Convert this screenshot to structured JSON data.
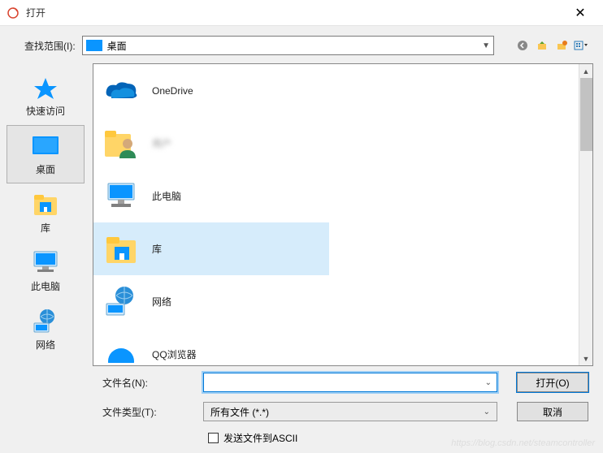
{
  "window": {
    "title": "打开",
    "close": "✕"
  },
  "lookIn": {
    "label": "查找范围(I):",
    "value": "桌面"
  },
  "navIcons": [
    "back-icon",
    "up-icon",
    "new-folder-icon",
    "view-menu-icon"
  ],
  "places": [
    {
      "id": "quick-access",
      "label": "快速访问",
      "selected": false
    },
    {
      "id": "desktop",
      "label": "桌面",
      "selected": true
    },
    {
      "id": "libraries",
      "label": "库",
      "selected": false
    },
    {
      "id": "this-pc",
      "label": "此电脑",
      "selected": false
    },
    {
      "id": "network",
      "label": "网络",
      "selected": false
    }
  ],
  "files": [
    {
      "id": "onedrive",
      "label": "OneDrive",
      "hover": false
    },
    {
      "id": "user",
      "label": "用户",
      "hover": false,
      "blurred": true
    },
    {
      "id": "this-pc",
      "label": "此电脑",
      "hover": false
    },
    {
      "id": "libraries",
      "label": "库",
      "hover": true
    },
    {
      "id": "network",
      "label": "网络",
      "hover": false
    },
    {
      "id": "qq-browser",
      "label": "QQ浏览器",
      "hover": false
    }
  ],
  "bottom": {
    "filenameLabel": "文件名(N):",
    "filenameValue": "",
    "filetypeLabel": "文件类型(T):",
    "filetypeValue": "所有文件 (*.*)",
    "openButton": "打开(O)",
    "cancelButton": "取消",
    "asciiCheckbox": "发送文件到ASCII"
  },
  "watermark": "https://blog.csdn.net/steamcontroller"
}
